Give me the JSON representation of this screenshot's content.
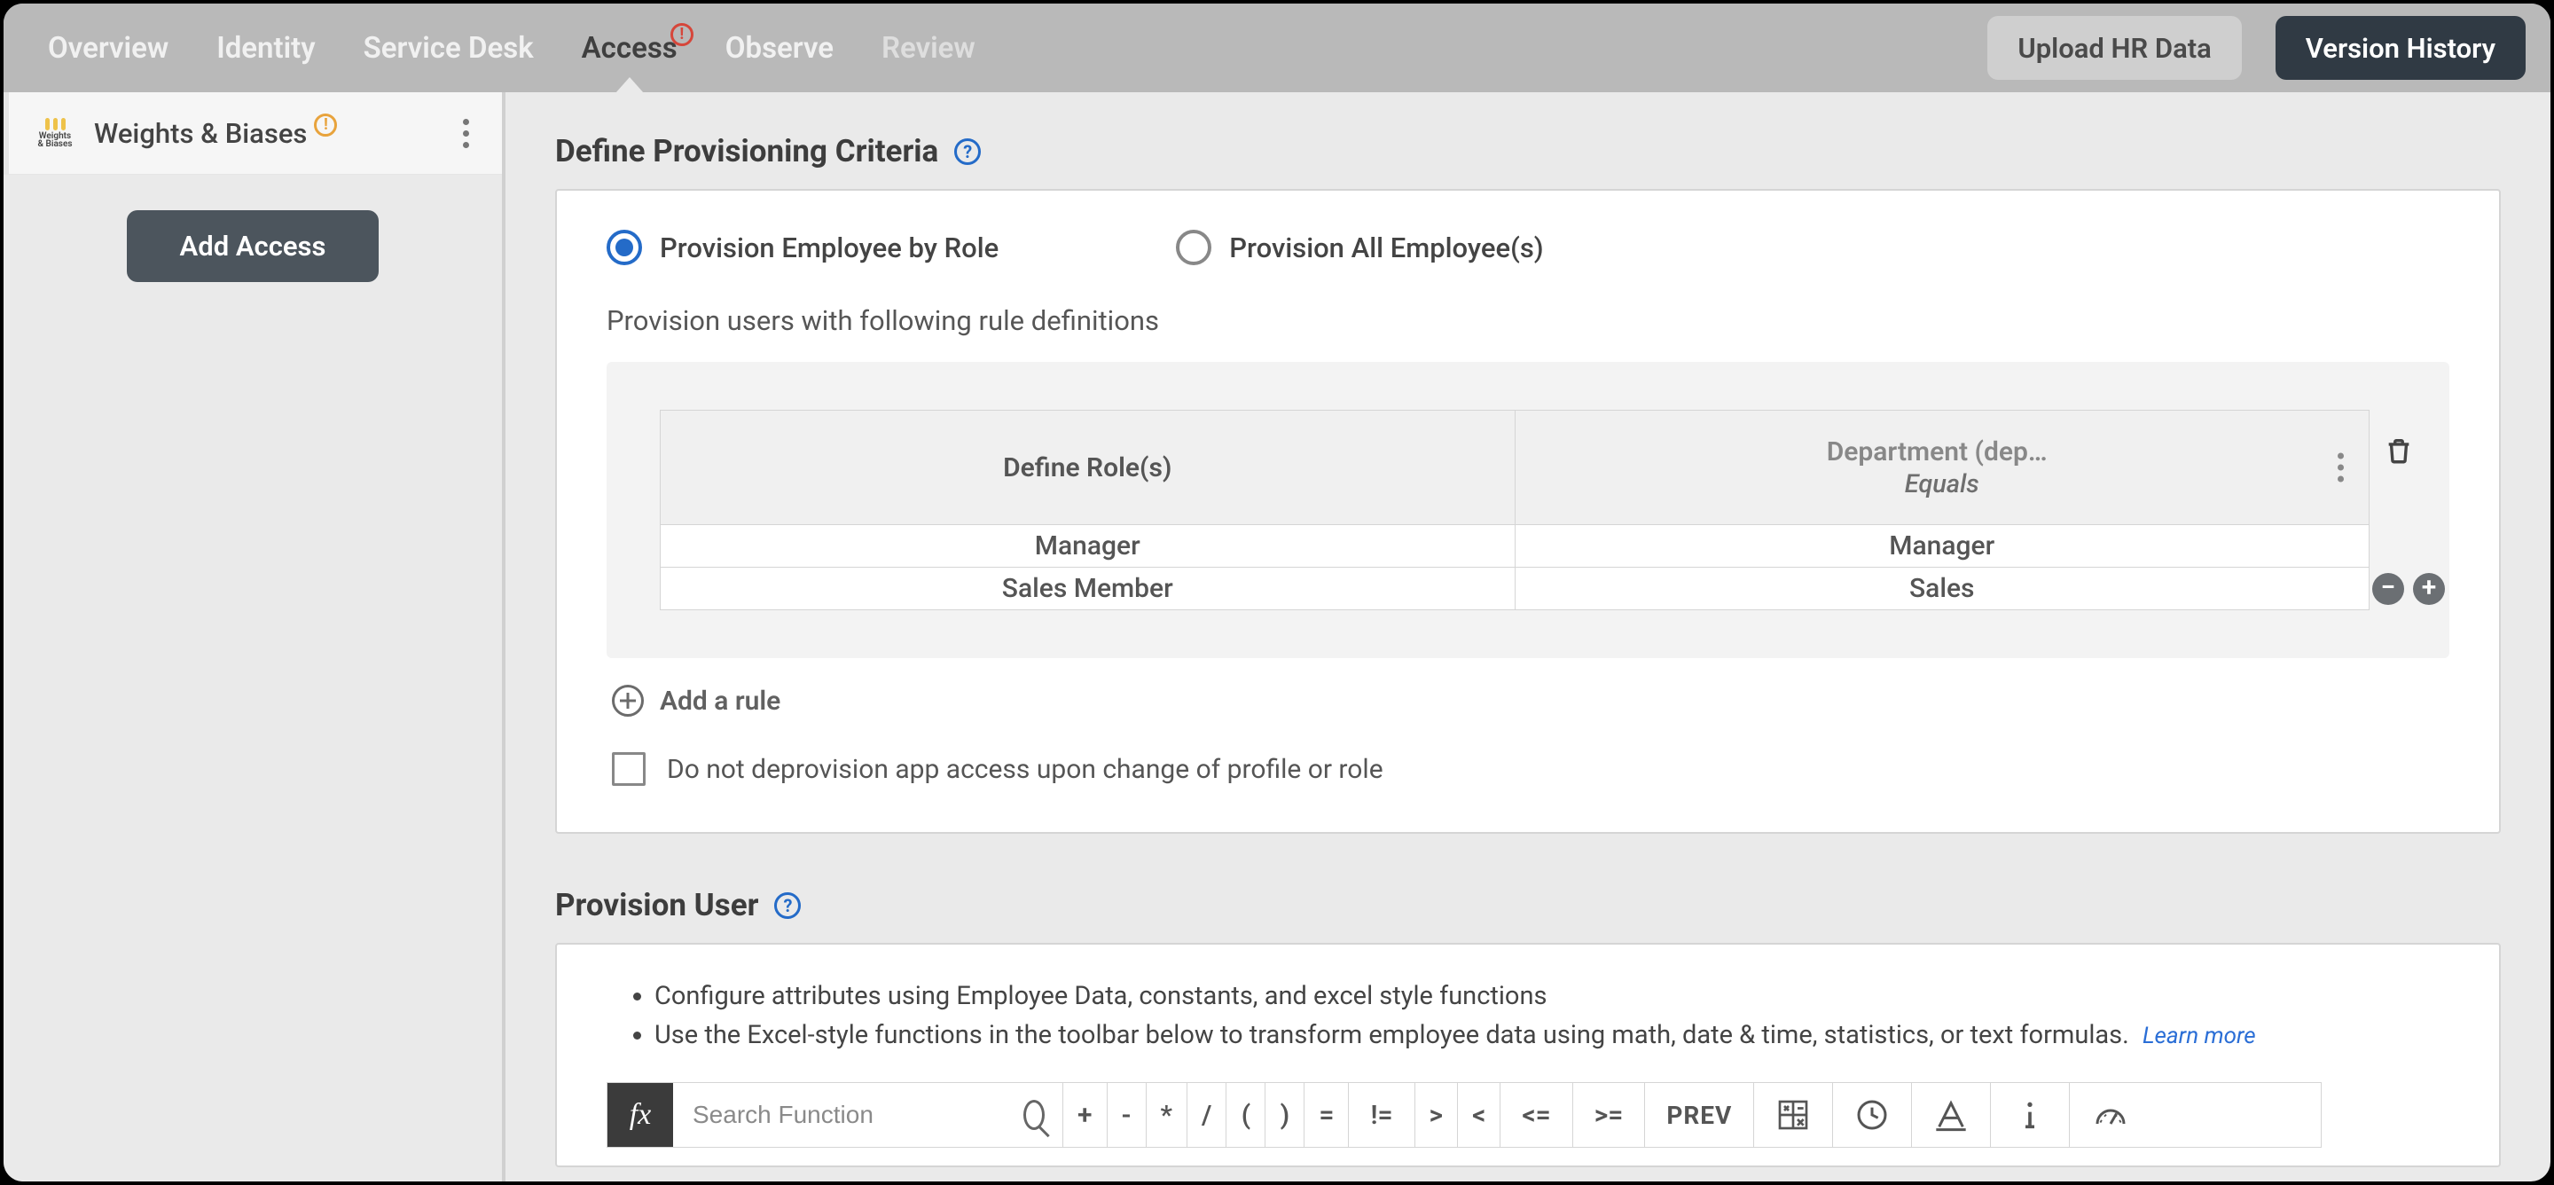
{
  "tabs": {
    "overview": "Overview",
    "identity": "Identity",
    "serviceDesk": "Service Desk",
    "access": "Access",
    "observe": "Observe",
    "review": "Review",
    "accessAlert": "!"
  },
  "headerButtons": {
    "upload": "Upload HR Data",
    "version": "Version History"
  },
  "sidebar": {
    "item": {
      "label": "Weights & Biases",
      "logoSub": "Weights & Biases",
      "warn": "!"
    },
    "addAccess": "Add Access"
  },
  "criteria": {
    "title": "Define Provisioning Criteria",
    "help": "?",
    "radio1": "Provision Employee by Role",
    "radio2": "Provision All Employee(s)",
    "subtext": "Provision users with following rule definitions",
    "table": {
      "col1": "Define Role(s)",
      "col2title": "Department (department_name)",
      "col2sub": "Equals",
      "rows": [
        {
          "role": "Manager",
          "value": "Manager"
        },
        {
          "role": "Sales Member",
          "value": "Sales"
        }
      ]
    },
    "addRule": "Add a rule",
    "checkbox": "Do not deprovision app access upon change of profile or role"
  },
  "provisionUser": {
    "title": "Provision User",
    "help": "?",
    "bullet1": "Configure attributes using Employee Data, constants, and excel style functions",
    "bullet2": "Use the Excel-style functions in the toolbar below to transform employee data using math, date & time, statistics, or text formulas.",
    "learnMore": "Learn more",
    "fx": "fx",
    "searchPlaceholder": "Search Function",
    "ops": {
      "plus": "+",
      "minus": "-",
      "mul": "*",
      "div": "/",
      "lp": "(",
      "rp": ")",
      "eq": "=",
      "neq": "!=",
      "gt": ">",
      "lt": "<",
      "lte": "<=",
      "gte": ">=",
      "prev": "PREV"
    }
  }
}
